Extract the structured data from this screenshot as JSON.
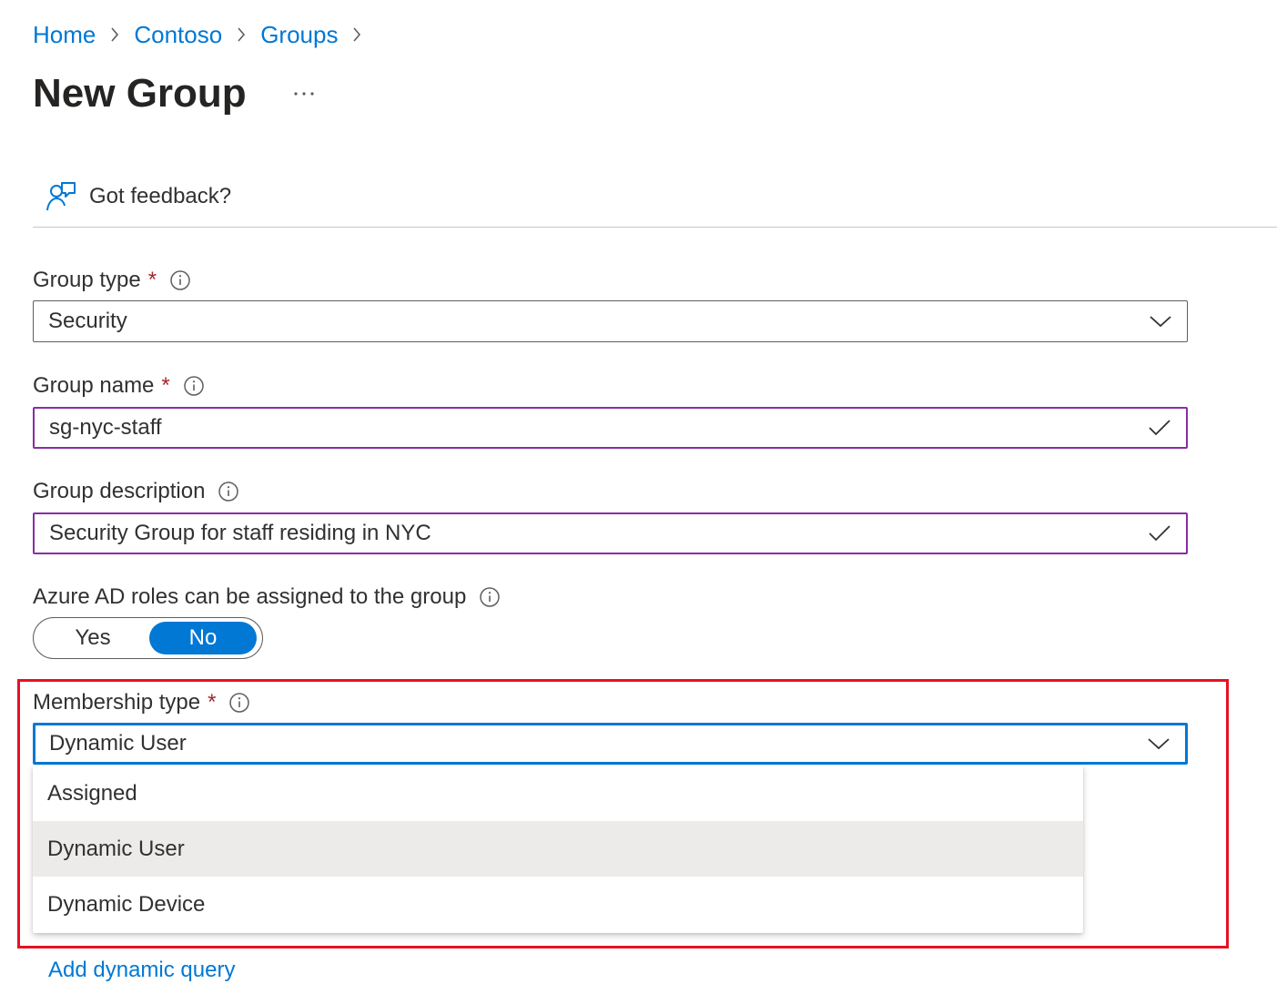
{
  "breadcrumb": {
    "items": [
      {
        "label": "Home"
      },
      {
        "label": "Contoso"
      },
      {
        "label": "Groups"
      }
    ]
  },
  "header": {
    "title": "New Group",
    "more_label": "···"
  },
  "toolbar": {
    "feedback_label": "Got feedback?",
    "feedback_icon": "feedback-person-icon"
  },
  "form": {
    "group_type": {
      "label": "Group type",
      "required": "*",
      "value": "Security"
    },
    "group_name": {
      "label": "Group name",
      "required": "*",
      "value": "sg-nyc-staff"
    },
    "group_description": {
      "label": "Group description",
      "value": "Security Group for staff residing in NYC"
    },
    "azure_ad_roles": {
      "label": "Azure AD roles can be assigned to the group",
      "options": [
        {
          "label": "Yes"
        },
        {
          "label": "No"
        }
      ],
      "selected": "No"
    },
    "membership_type": {
      "label": "Membership type",
      "required": "*",
      "value": "Dynamic User",
      "options": [
        {
          "label": "Assigned"
        },
        {
          "label": "Dynamic User"
        },
        {
          "label": "Dynamic Device"
        }
      ],
      "highlighted_option": "Dynamic User"
    }
  },
  "links": {
    "add_dynamic_query": "Add dynamic query"
  },
  "colors": {
    "link": "#0078d4",
    "required": "#a4262c",
    "valid_border": "#8a2da5",
    "focus_border": "#0078d4",
    "highlight": "#e81123"
  }
}
